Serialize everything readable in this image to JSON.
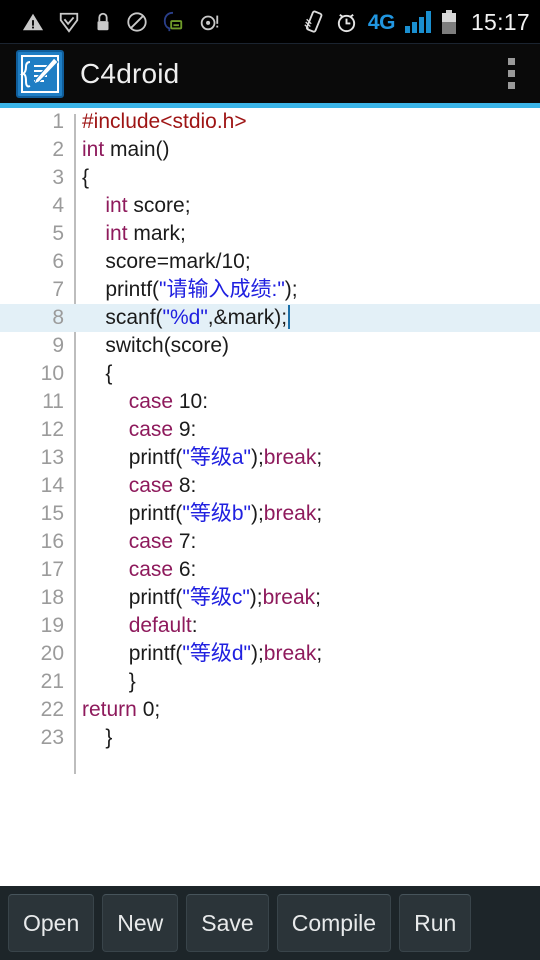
{
  "status_bar": {
    "left_icons": [
      {
        "name": "warning-triangle-icon",
        "glyph": "warning"
      },
      {
        "name": "shield-check-icon",
        "glyph": "shield"
      },
      {
        "name": "lock-icon",
        "glyph": "lock"
      },
      {
        "name": "do-not-disturb-icon",
        "glyph": "no-entry"
      },
      {
        "name": "assistant-message-icon",
        "glyph": "assistant"
      },
      {
        "name": "alarm-disc-icon",
        "glyph": "disc"
      }
    ],
    "right_icons": [
      {
        "name": "vibrate-icon",
        "glyph": "phone-vibrate"
      },
      {
        "name": "alarm-clock-icon",
        "glyph": "alarm"
      }
    ],
    "network_type": "4G",
    "signal_bars": 4,
    "battery_level_pct": 55,
    "clock": "15:17",
    "accent_color": "#2196e0"
  },
  "action_bar": {
    "app_title": "C4droid",
    "icon_name": "c4droid-app-icon",
    "overflow_label": "⋮",
    "accent_color": "#3bb5e8"
  },
  "editor": {
    "active_line": 8,
    "background": "#ffffff",
    "active_line_background": "#e3f0f7",
    "caret_color": "#1b6fa8",
    "colors": {
      "keyword": "#8e1a5c",
      "preprocessor": "#9e1414",
      "string": "#2020e0",
      "plain": "#1b1b1b",
      "gutter_text": "#9b9b9b"
    },
    "lines": [
      {
        "n": "1",
        "indent": 0,
        "tokens": [
          {
            "t": "#include<stdio.h>",
            "c": "pre"
          }
        ]
      },
      {
        "n": "2",
        "indent": 0,
        "tokens": [
          {
            "t": "int",
            "c": "kw"
          },
          {
            "t": " main()",
            "c": ""
          }
        ]
      },
      {
        "n": "3",
        "indent": 0,
        "tokens": [
          {
            "t": "{",
            "c": ""
          }
        ]
      },
      {
        "n": "4",
        "indent": 1,
        "tokens": [
          {
            "t": "int",
            "c": "kw"
          },
          {
            "t": " score;",
            "c": ""
          }
        ]
      },
      {
        "n": "5",
        "indent": 1,
        "tokens": [
          {
            "t": "int",
            "c": "kw"
          },
          {
            "t": " mark;",
            "c": ""
          }
        ]
      },
      {
        "n": "6",
        "indent": 1,
        "tokens": [
          {
            "t": "score=mark/10;",
            "c": ""
          }
        ]
      },
      {
        "n": "7",
        "indent": 1,
        "tokens": [
          {
            "t": "printf(",
            "c": ""
          },
          {
            "t": "\"请输入成绩:\"",
            "c": "str"
          },
          {
            "t": ");",
            "c": ""
          }
        ]
      },
      {
        "n": "8",
        "indent": 1,
        "tokens": [
          {
            "t": "scanf(",
            "c": ""
          },
          {
            "t": "\"%d\"",
            "c": "str"
          },
          {
            "t": ",&mark);",
            "c": ""
          }
        ],
        "caret": true
      },
      {
        "n": "9",
        "indent": 1,
        "tokens": [
          {
            "t": "switch(score)",
            "c": ""
          }
        ]
      },
      {
        "n": "10",
        "indent": 1,
        "tokens": [
          {
            "t": "{",
            "c": ""
          }
        ]
      },
      {
        "n": "11",
        "indent": 2,
        "tokens": [
          {
            "t": "case",
            "c": "kw"
          },
          {
            "t": " 10:",
            "c": ""
          }
        ]
      },
      {
        "n": "12",
        "indent": 2,
        "tokens": [
          {
            "t": "case",
            "c": "kw"
          },
          {
            "t": " 9:",
            "c": ""
          }
        ]
      },
      {
        "n": "13",
        "indent": 2,
        "tokens": [
          {
            "t": "printf(",
            "c": ""
          },
          {
            "t": "\"等级a\"",
            "c": "str"
          },
          {
            "t": ");",
            "c": ""
          },
          {
            "t": "break",
            "c": "kw"
          },
          {
            "t": ";",
            "c": ""
          }
        ]
      },
      {
        "n": "14",
        "indent": 2,
        "tokens": [
          {
            "t": "case",
            "c": "kw"
          },
          {
            "t": " 8:",
            "c": ""
          }
        ]
      },
      {
        "n": "15",
        "indent": 2,
        "tokens": [
          {
            "t": "printf(",
            "c": ""
          },
          {
            "t": "\"等级b\"",
            "c": "str"
          },
          {
            "t": ");",
            "c": ""
          },
          {
            "t": "break",
            "c": "kw"
          },
          {
            "t": ";",
            "c": ""
          }
        ]
      },
      {
        "n": "16",
        "indent": 2,
        "tokens": [
          {
            "t": "case",
            "c": "kw"
          },
          {
            "t": " 7:",
            "c": ""
          }
        ]
      },
      {
        "n": "17",
        "indent": 2,
        "tokens": [
          {
            "t": "case",
            "c": "kw"
          },
          {
            "t": " 6:",
            "c": ""
          }
        ]
      },
      {
        "n": "18",
        "indent": 2,
        "tokens": [
          {
            "t": "printf(",
            "c": ""
          },
          {
            "t": "\"等级c\"",
            "c": "str"
          },
          {
            "t": ");",
            "c": ""
          },
          {
            "t": "break",
            "c": "kw"
          },
          {
            "t": ";",
            "c": ""
          }
        ]
      },
      {
        "n": "19",
        "indent": 2,
        "tokens": [
          {
            "t": "default",
            "c": "kw"
          },
          {
            "t": ":",
            "c": ""
          }
        ]
      },
      {
        "n": "20",
        "indent": 2,
        "tokens": [
          {
            "t": "printf(",
            "c": ""
          },
          {
            "t": "\"等级d\"",
            "c": "str"
          },
          {
            "t": ");",
            "c": ""
          },
          {
            "t": "break",
            "c": "kw"
          },
          {
            "t": ";",
            "c": ""
          }
        ]
      },
      {
        "n": "21",
        "indent": 2,
        "tokens": [
          {
            "t": "}",
            "c": ""
          }
        ]
      },
      {
        "n": "22",
        "indent": 0,
        "tokens": [
          {
            "t": "return",
            "c": "kw"
          },
          {
            "t": " 0;",
            "c": ""
          }
        ]
      },
      {
        "n": "23",
        "indent": 1,
        "tokens": [
          {
            "t": "}",
            "c": ""
          }
        ]
      }
    ]
  },
  "button_bar": {
    "background": "#1d2529",
    "buttons": [
      {
        "name": "open-button",
        "label": "Open"
      },
      {
        "name": "new-button",
        "label": "New"
      },
      {
        "name": "save-button",
        "label": "Save"
      },
      {
        "name": "compile-button",
        "label": "Compile"
      },
      {
        "name": "run-button",
        "label": "Run"
      }
    ]
  }
}
